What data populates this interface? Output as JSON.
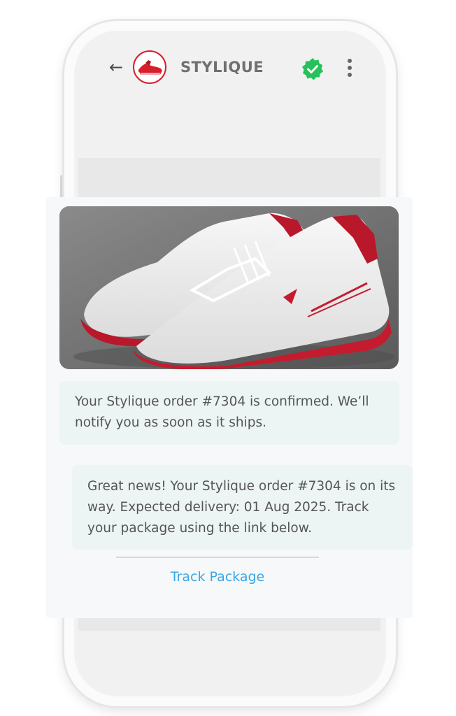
{
  "header": {
    "back_icon": "arrow-left-icon",
    "brand_name": "STYLIQUE",
    "verified_icon": "verified-check-icon",
    "verified_color": "#25c25a",
    "menu_icon": "more-vertical-icon"
  },
  "messages": {
    "product_image": "red-white-sneakers",
    "confirmation_text": "Your Stylique order #7304 is confirmed. We’ll notify you as soon as it ships.",
    "shipping_text": "Great news! Your Stylique order #7304 is on its way. Expected delivery: 01 Aug 2025. Track your package using the link below.",
    "track_link": "Track Package",
    "link_color": "#3ba6e8"
  }
}
